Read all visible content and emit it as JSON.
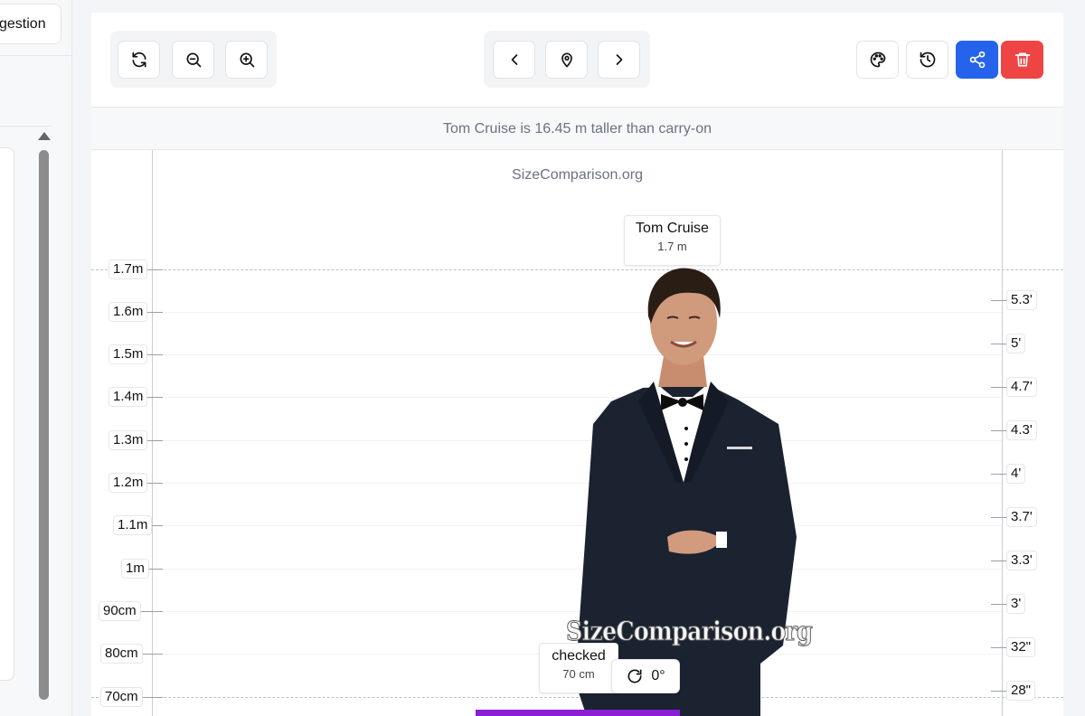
{
  "sidebar": {
    "suggestion_button": "gestion"
  },
  "toolbar": {
    "left_group": [
      "refresh-icon",
      "zoom-out-icon",
      "zoom-in-icon"
    ],
    "center_group": [
      "chevron-left-icon",
      "map-pin-icon",
      "chevron-right-icon"
    ],
    "right_group": [
      "palette-icon",
      "history-icon",
      "share-icon",
      "trash-icon"
    ],
    "colors": {
      "share": "#2563eb",
      "delete": "#ef4444"
    }
  },
  "comparison_text": "Tom Cruise is 16.45 m taller than carry-on",
  "canvas": {
    "watermark": "SizeComparison.org",
    "left_axis_labels": [
      "1.7m",
      "1.6m",
      "1.5m",
      "1.4m",
      "1.3m",
      "1.2m",
      "1.1m",
      "1m",
      "90cm",
      "80cm",
      "70cm"
    ],
    "right_axis_labels": [
      "5.3'",
      "5'",
      "4.7'",
      "4.3'",
      "4'",
      "3.7'",
      "3.3'",
      "3'",
      "32\"",
      "28\""
    ],
    "objects": [
      {
        "name": "Tom Cruise",
        "height": "1.7 m"
      },
      {
        "name": "checked",
        "height": "70 cm",
        "color": "#8a1fd4"
      }
    ],
    "rotation": "0°",
    "image_watermark": "SizeComparison.org"
  }
}
